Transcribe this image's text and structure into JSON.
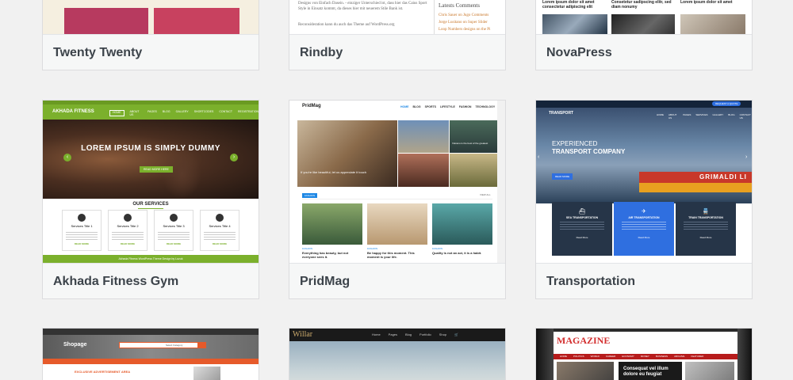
{
  "themes": [
    {
      "name": "Twenty Twenty"
    },
    {
      "name": "Rindby",
      "preview": {
        "para1": "Designs von Einfach Dasein. - einziger Unterschied ist, dass hier das Caius Sport Style in Einsatz kommt, da dieses hier mit neuerem Stile Bank ist.",
        "para2": "Reconsideration kann du auch das Theme auf WordPress.org",
        "sidebar_heading": "Latests Comments",
        "comments": [
          "Chris Sauer on Jugo Comments",
          "Jorge Lusitano on Super Slider",
          "Loop Numbers designs on the Pi"
        ]
      }
    },
    {
      "name": "NovaPress",
      "preview": {
        "posts": [
          "Lorem ipsum dolor sit amet consectetur adipiscing elit",
          "Consetetur sadipscing elitr, sed diam nonumy",
          "Lorem ipsum dolor sit amet"
        ]
      }
    },
    {
      "name": "Akhada Fitness Gym",
      "preview": {
        "logo": "AKHADA FITNESS",
        "nav": [
          "HOME",
          "ABOUT US",
          "PAGES",
          "BLOG",
          "GALLERY",
          "SHORTCODES",
          "CONTACT",
          "REGISTRATION"
        ],
        "hero_title": "LOREM IPSUM IS SIMPLY DUMMY",
        "hero_btn": "READ MORE HERE",
        "services_title": "OUR SERVICES",
        "services": [
          "Services Title 1",
          "Services Title 2",
          "Services Title 3",
          "Services Title 4"
        ],
        "service_btn": "READ MORE",
        "footer": "Akhada Fitness WordPress Theme Design by Luzuk"
      }
    },
    {
      "name": "PridMag",
      "preview": {
        "logo": "PridMag",
        "nav": [
          "HOME",
          "BLOG",
          "SPORTS",
          "LIFESTYLE",
          "FASHION",
          "TECHNOLOGY"
        ],
        "hero_caption": "If you're like beautiful, let us appreciate it touch",
        "tile_caption": "Volcano is the best of the greatest",
        "section_label": "FASHION",
        "more": "VIEW ALL",
        "articles": [
          {
            "cat": "FASHION",
            "title": "Everything has beauty, but not everyone sees it."
          },
          {
            "cat": "FASHION",
            "title": "Be happy for this moment. This moment is your life."
          },
          {
            "cat": "FASHION",
            "title": "Quality is not an act, it is a habit."
          }
        ]
      }
    },
    {
      "name": "Transportation",
      "preview": {
        "logo": "TRANSPORT",
        "quote_btn": "REQUEST A QUOTE",
        "nav": [
          "HOME",
          "ABOUT US",
          "PAGES",
          "SERVICES",
          "GALLERY",
          "BLOG",
          "CONTACT US"
        ],
        "hero_line1": "EXPERIENCED",
        "hero_line2": "TRANSPORT COMPANY",
        "hero_btn": "READ MORE",
        "ship_text": "GRIMALDI LI",
        "services": [
          "SEA TRANSPORTATION",
          "AIR TRANSPORTATION",
          "TRAIN TRANSPORTATION"
        ],
        "service_btn": "Read More"
      }
    },
    {
      "name": "Shopage",
      "preview": {
        "logo": "Shopage",
        "banner": "EXCLUSIVE ADVERTISEMENT AREA",
        "search": "Select Category"
      }
    },
    {
      "name": "Willar",
      "preview": {
        "logo": "Willar",
        "nav": [
          "Home",
          "Pages",
          "Blog",
          "Portfolio",
          "Shop"
        ]
      }
    },
    {
      "name": "Magazine",
      "preview": {
        "logo": "MAGAZINE",
        "nav": [
          "HOME",
          "POLITICS",
          "WORLD",
          "CAREER",
          "ECONOMY",
          "MONEY",
          "BUSINESS",
          "ARCHIVE",
          "FEATURED"
        ],
        "headline": "Consequat vel illum dolore eu feugiat"
      }
    }
  ]
}
